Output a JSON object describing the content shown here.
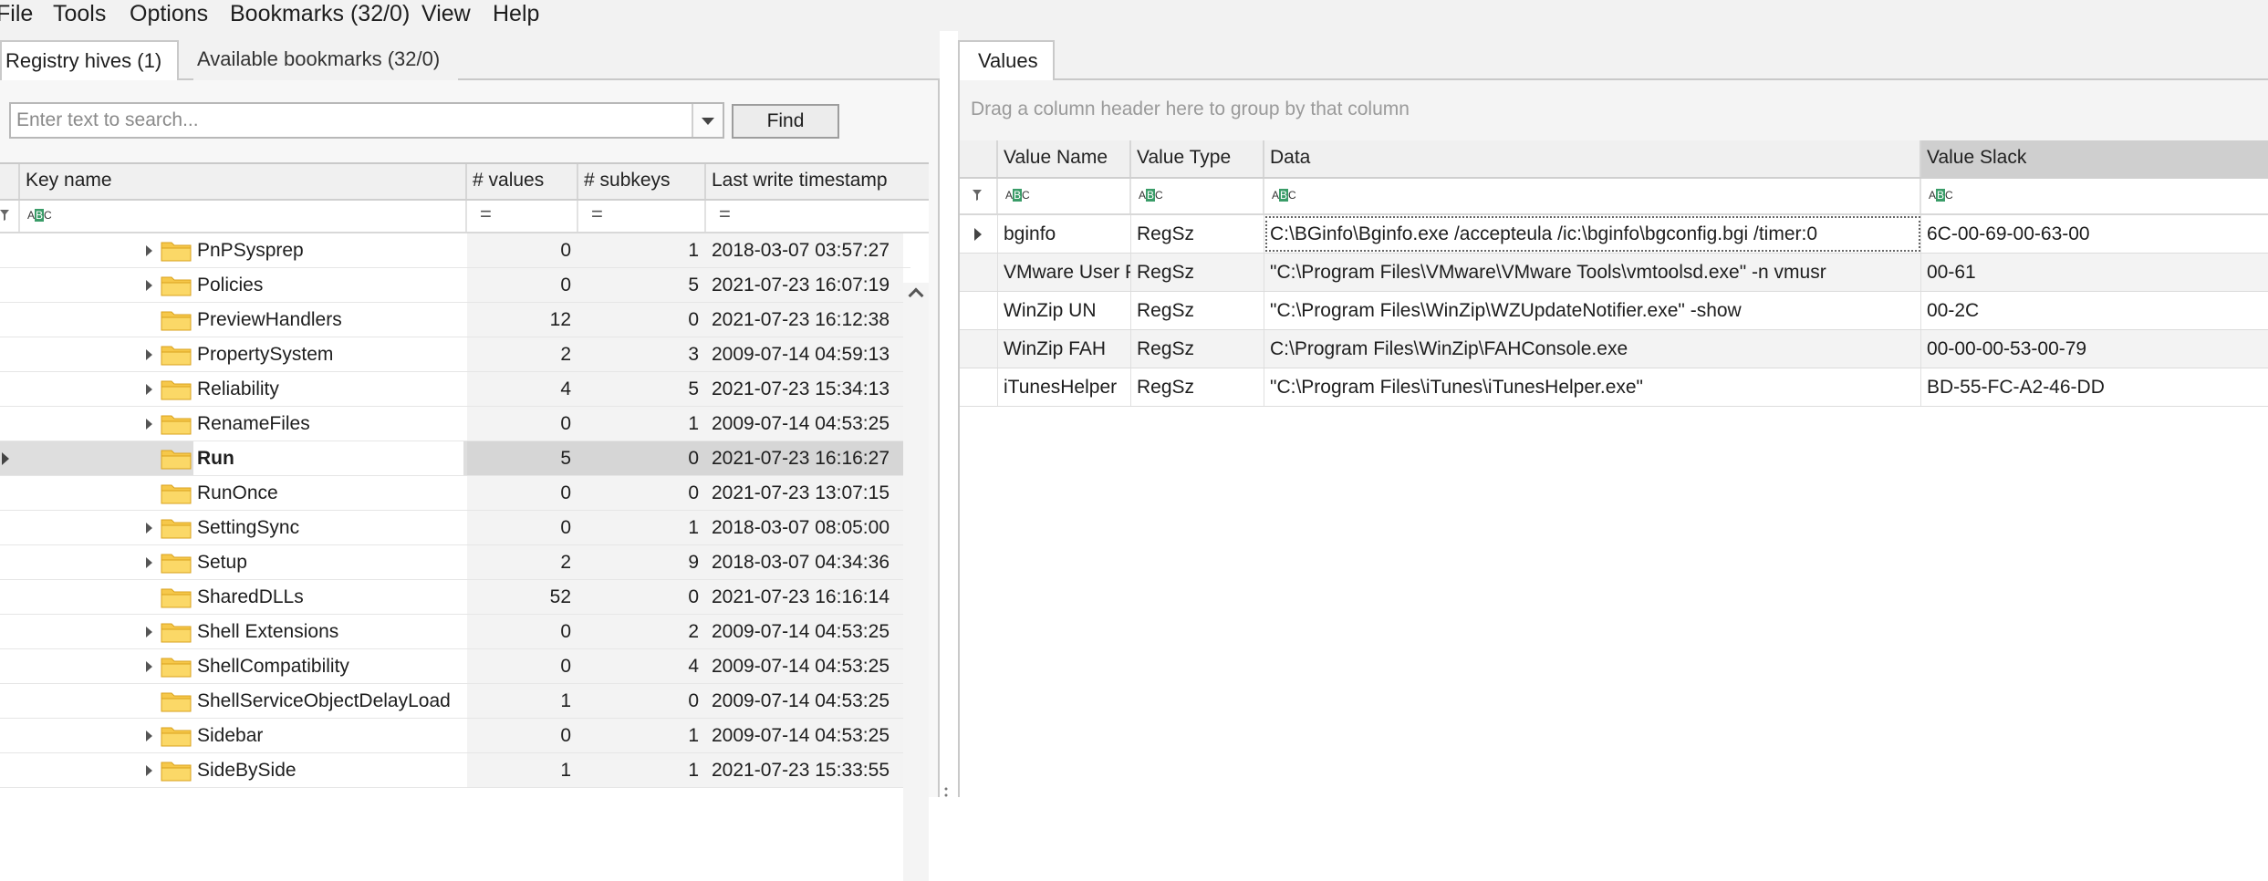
{
  "menubar": {
    "items": [
      "File",
      "Tools",
      "Options",
      "Bookmarks (32/0)",
      "View",
      "Help"
    ]
  },
  "left_tabs": [
    "Registry hives (1)",
    "Available bookmarks (32/0)"
  ],
  "search": {
    "placeholder": "Enter text to search...",
    "value": "",
    "find_label": "Find"
  },
  "tree_grid": {
    "columns": [
      "Key name",
      "# values",
      "# subkeys",
      "Last write timestamp"
    ],
    "filter_abc": "ABC",
    "filter_eq": "=",
    "rows": [
      {
        "name": "PnPSysprep",
        "values": "0",
        "subkeys": "1",
        "timestamp": "2018-03-07 03:57:27",
        "expandable": true,
        "selected": false
      },
      {
        "name": "Policies",
        "values": "0",
        "subkeys": "5",
        "timestamp": "2021-07-23 16:07:19",
        "expandable": true,
        "selected": false
      },
      {
        "name": "PreviewHandlers",
        "values": "12",
        "subkeys": "0",
        "timestamp": "2021-07-23 16:12:38",
        "expandable": false,
        "selected": false
      },
      {
        "name": "PropertySystem",
        "values": "2",
        "subkeys": "3",
        "timestamp": "2009-07-14 04:59:13",
        "expandable": true,
        "selected": false
      },
      {
        "name": "Reliability",
        "values": "4",
        "subkeys": "5",
        "timestamp": "2021-07-23 15:34:13",
        "expandable": true,
        "selected": false
      },
      {
        "name": "RenameFiles",
        "values": "0",
        "subkeys": "1",
        "timestamp": "2009-07-14 04:53:25",
        "expandable": true,
        "selected": false
      },
      {
        "name": "Run",
        "values": "5",
        "subkeys": "0",
        "timestamp": "2021-07-23 16:16:27",
        "expandable": false,
        "selected": true
      },
      {
        "name": "RunOnce",
        "values": "0",
        "subkeys": "0",
        "timestamp": "2021-07-23 13:07:15",
        "expandable": false,
        "selected": false
      },
      {
        "name": "SettingSync",
        "values": "0",
        "subkeys": "1",
        "timestamp": "2018-03-07 08:05:00",
        "expandable": true,
        "selected": false
      },
      {
        "name": "Setup",
        "values": "2",
        "subkeys": "9",
        "timestamp": "2018-03-07 04:34:36",
        "expandable": true,
        "selected": false
      },
      {
        "name": "SharedDLLs",
        "values": "52",
        "subkeys": "0",
        "timestamp": "2021-07-23 16:16:14",
        "expandable": false,
        "selected": false
      },
      {
        "name": "Shell Extensions",
        "values": "0",
        "subkeys": "2",
        "timestamp": "2009-07-14 04:53:25",
        "expandable": true,
        "selected": false
      },
      {
        "name": "ShellCompatibility",
        "values": "0",
        "subkeys": "4",
        "timestamp": "2009-07-14 04:53:25",
        "expandable": true,
        "selected": false
      },
      {
        "name": "ShellServiceObjectDelayLoad",
        "values": "1",
        "subkeys": "0",
        "timestamp": "2009-07-14 04:53:25",
        "expandable": false,
        "selected": false
      },
      {
        "name": "Sidebar",
        "values": "0",
        "subkeys": "1",
        "timestamp": "2009-07-14 04:53:25",
        "expandable": true,
        "selected": false
      },
      {
        "name": "SideBySide",
        "values": "1",
        "subkeys": "1",
        "timestamp": "2021-07-23 15:33:55",
        "expandable": true,
        "selected": false
      }
    ]
  },
  "values_tab": "Values",
  "values_grid": {
    "group_hint": "Drag a column header here to group by that column",
    "columns": [
      "Value Name",
      "Value Type",
      "Data",
      "Value Slack"
    ],
    "rows": [
      {
        "name": "bginfo",
        "type": "RegSz",
        "data": "C:\\BGinfo\\Bginfo.exe /accepteula /ic:\\bginfo\\bgconfig.bgi /timer:0",
        "slack": "6C-00-69-00-63-00"
      },
      {
        "name": "VMware User Process",
        "type": "RegSz",
        "data": "\"C:\\Program Files\\VMware\\VMware Tools\\vmtoolsd.exe\" -n vmusr",
        "slack": "00-61"
      },
      {
        "name": "WinZip UN",
        "type": "RegSz",
        "data": "\"C:\\Program Files\\WinZip\\WZUpdateNotifier.exe\" -show",
        "slack": "00-2C"
      },
      {
        "name": "WinZip FAH",
        "type": "RegSz",
        "data": "C:\\Program Files\\WinZip\\FAHConsole.exe",
        "slack": "00-00-00-53-00-79"
      },
      {
        "name": "iTunesHelper",
        "type": "RegSz",
        "data": "\"C:\\Program Files\\iTunes\\iTunesHelper.exe\"",
        "slack": "BD-55-FC-A2-46-DD"
      }
    ]
  },
  "colors": {
    "folder": "#f6c84a",
    "abc_badge": "#3a9c68",
    "selected_row": "#dedede"
  }
}
